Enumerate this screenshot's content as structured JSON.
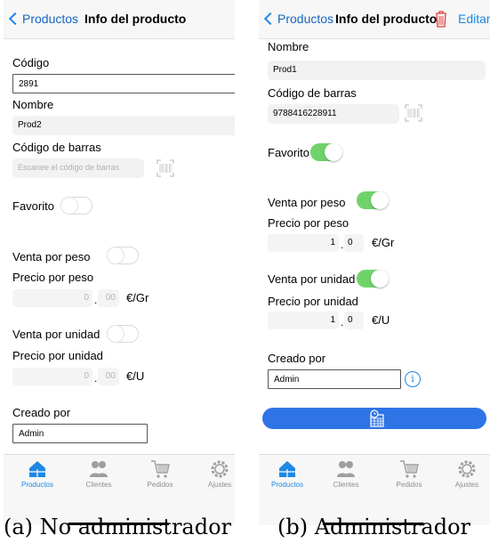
{
  "screens": {
    "a": {
      "nav": {
        "back_label": "Productos",
        "title": "Info del producto"
      },
      "codigo": {
        "label": "Código",
        "value": "2891"
      },
      "nombre": {
        "label": "Nombre",
        "value": "Prod2"
      },
      "barcode": {
        "label": "Código de barras",
        "placeholder": "Escanee el código de barras"
      },
      "favorito": {
        "label": "Favorito",
        "on": false
      },
      "venta_peso": {
        "label": "Venta por peso",
        "on": false
      },
      "precio_peso": {
        "label": "Precio por peso",
        "int": "0",
        "dec": "00",
        "unit": "€/Gr"
      },
      "venta_unidad": {
        "label": "Venta por unidad",
        "on": false
      },
      "precio_unidad": {
        "label": "Precio por unidad",
        "int": "0",
        "dec": "00",
        "unit": "€/U"
      },
      "creado": {
        "label": "Creado por",
        "value": "Admin"
      },
      "caption": "(a) No administrador"
    },
    "b": {
      "nav": {
        "back_label": "Productos",
        "title": "Info del producto",
        "edit_label": "Editar"
      },
      "nombre": {
        "label": "Nombre",
        "value": "Prod1"
      },
      "barcode": {
        "label": "Código de barras",
        "value": "9788416228911"
      },
      "favorito": {
        "label": "Favorito",
        "on": true
      },
      "venta_peso": {
        "label": "Venta por peso",
        "on": true
      },
      "precio_peso": {
        "label": "Precio por peso",
        "int": "1",
        "dec": "0",
        "unit": "€/Gr"
      },
      "venta_unidad": {
        "label": "Venta por unidad",
        "on": true
      },
      "precio_unidad": {
        "label": "Precio por unidad",
        "int": "1",
        "dec": "0",
        "unit": "€/U"
      },
      "creado": {
        "label": "Creado por",
        "value": "Admin"
      },
      "caption": "(b) Administrador"
    }
  },
  "tabs": [
    {
      "label": "Productos",
      "icon": "home-icon",
      "active": true
    },
    {
      "label": "Clientes",
      "icon": "users-icon",
      "active": false
    },
    {
      "label": "Pedidos",
      "icon": "cart-icon",
      "active": false
    },
    {
      "label": "Ajustes",
      "icon": "gear-icon",
      "active": false
    }
  ],
  "decimal_separator": ".",
  "colors": {
    "accent": "#1e88e5",
    "toggle_on": "#6fd36a",
    "trash": "#e53935",
    "button": "#2f74e6"
  }
}
